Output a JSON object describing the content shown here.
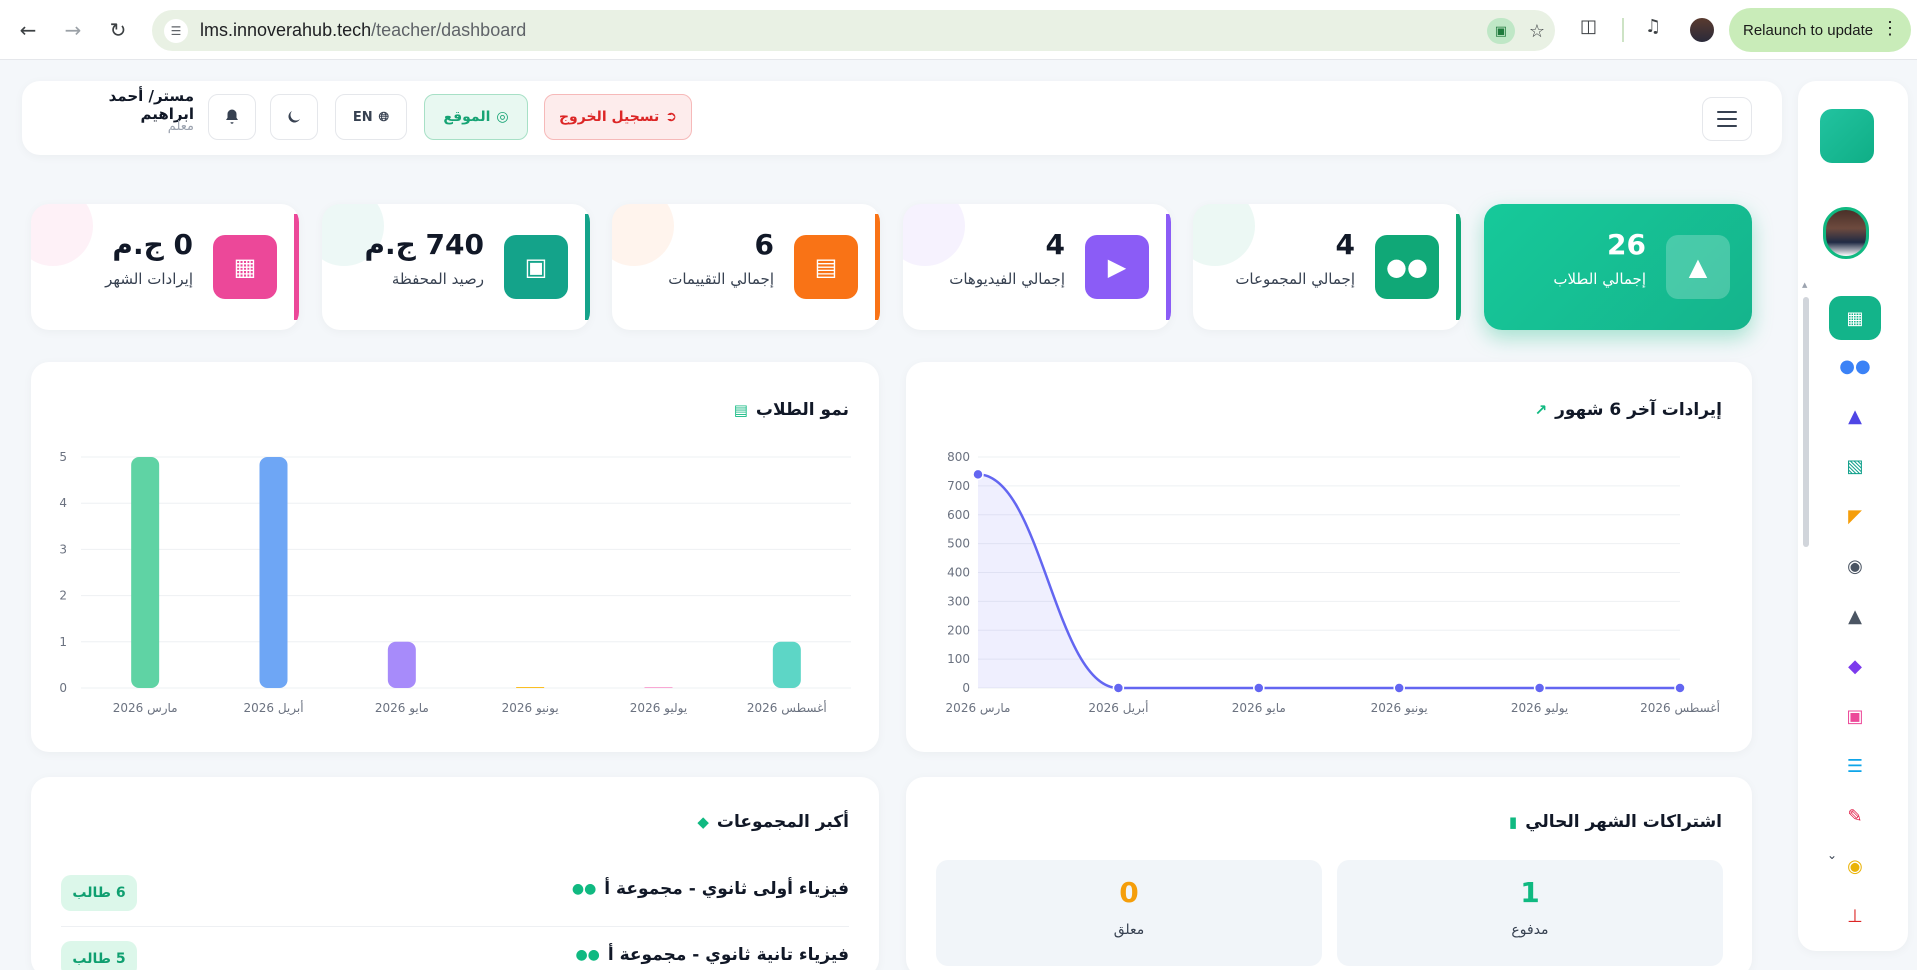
{
  "browser": {
    "url_host": "lms.innoverahub.tech",
    "url_path": "/teacher/dashboard",
    "relaunch_label": "Relaunch to update"
  },
  "header": {
    "user_name": "مستر/ أحمد ابراهيم",
    "user_role": "معلم",
    "lang_label": "EN",
    "site_label": "الموقع",
    "logout_label": "تسجيل الخروج"
  },
  "stats": [
    {
      "value": "26",
      "label": "إجمالي الطلاب",
      "icon": "graduate-icon",
      "color": "#14b88d"
    },
    {
      "value": "4",
      "label": "إجمالي المجموعات",
      "icon": "users-icon",
      "color": "#10a877"
    },
    {
      "value": "4",
      "label": "إجمالي الفيديوهات",
      "icon": "play-icon",
      "color": "#8b5cf6"
    },
    {
      "value": "6",
      "label": "إجمالي التقييمات",
      "icon": "clipboard-icon",
      "color": "#f97316"
    },
    {
      "value": "740 ج.م",
      "label": "رصيد المحفظة",
      "icon": "wallet-icon",
      "color": "#14a38a"
    },
    {
      "value": "0 ج.م",
      "label": "إيرادات الشهر",
      "icon": "money-icon",
      "color": "#ec4899"
    }
  ],
  "revenue_panel": {
    "title": "إيرادات آخر 6 شهور"
  },
  "growth_panel": {
    "title": "نمو الطلاب"
  },
  "subscriptions_panel": {
    "title": "اشتراكات الشهر الحالي",
    "paid_value": "1",
    "paid_label": "مدفوع",
    "pending_value": "0",
    "pending_label": "معلق"
  },
  "groups_panel": {
    "title": "أكبر المجموعات",
    "groups": [
      {
        "name": "فيزياء أولى ثانوي - مجموعة أ",
        "count": "6 طالب"
      },
      {
        "name": "فيزياء تانية ثانوي - مجموعة أ",
        "count": "5 طالب"
      }
    ]
  },
  "chart_data": [
    {
      "type": "area",
      "title": "إيرادات آخر 6 شهور",
      "categories": [
        "مارس 2026",
        "أبريل 2026",
        "مايو 2026",
        "يونيو 2026",
        "يوليو 2026",
        "أغسطس 2026"
      ],
      "series": [
        {
          "values": [
            740,
            0,
            0,
            0,
            0,
            0
          ]
        }
      ],
      "ylim": [
        0,
        800
      ],
      "yticks": [
        0,
        100,
        200,
        300,
        400,
        500,
        600,
        700,
        800
      ],
      "color": "#6366f1",
      "grid": true
    },
    {
      "type": "bar",
      "title": "نمو الطلاب",
      "categories": [
        "مارس 2026",
        "أبريل 2026",
        "مايو 2026",
        "يونيو 2026",
        "يوليو 2026",
        "أغسطس 2026"
      ],
      "values": [
        5,
        5,
        1,
        0,
        0,
        1
      ],
      "colors": [
        "#5fd3a4",
        "#6ea6f5",
        "#a78bfa",
        "#fbbf24",
        "#f9a8d4",
        "#5dd6c6"
      ],
      "ylim": [
        0,
        5
      ],
      "yticks": [
        0,
        1,
        2,
        3,
        4,
        5
      ],
      "grid": true
    }
  ]
}
